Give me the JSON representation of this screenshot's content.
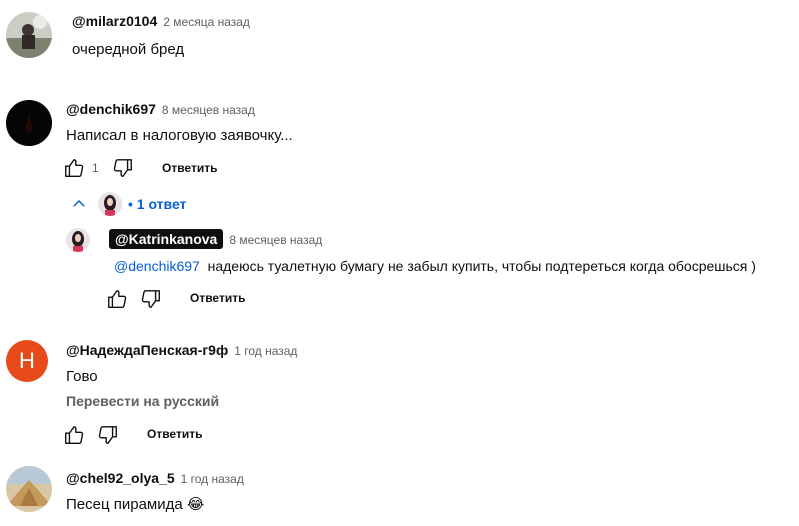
{
  "colors": {
    "link": "#065fd4",
    "text": "#0f0f0f",
    "meta": "#606060",
    "avatar_n": "#e64a19"
  },
  "icons": {
    "like": "thumbs-up-icon",
    "dislike": "thumbs-down-icon",
    "collapse": "chevron-up-icon"
  },
  "comments": [
    {
      "author": "@milarz0104",
      "time": "2 месяца назад",
      "text": "очередной бред"
    },
    {
      "author": "@denchik697",
      "time": "8 месяцев назад",
      "text": "Написал в налоговую заявочку...",
      "likes": "1",
      "reply_label": "Ответить",
      "replies_toggle": "• 1 ответ",
      "reply": {
        "author": "@Katrinkanova",
        "time": "8 месяцев назад",
        "mention": "@denchik697",
        "text": "надеюсь туалетную бумагу не забыл купить, чтобы подтереться когда обосрешься )",
        "reply_label": "Ответить"
      }
    },
    {
      "author": "@НадеждаПенская-г9ф",
      "time": "1 год назад",
      "avatar_letter": "Н",
      "text": "Гово",
      "translate": "Перевести на русский",
      "reply_label": "Ответить"
    },
    {
      "author": "@chel92_olya_5",
      "time": "1 год назад",
      "text": "Песец пирамида 😂"
    }
  ]
}
